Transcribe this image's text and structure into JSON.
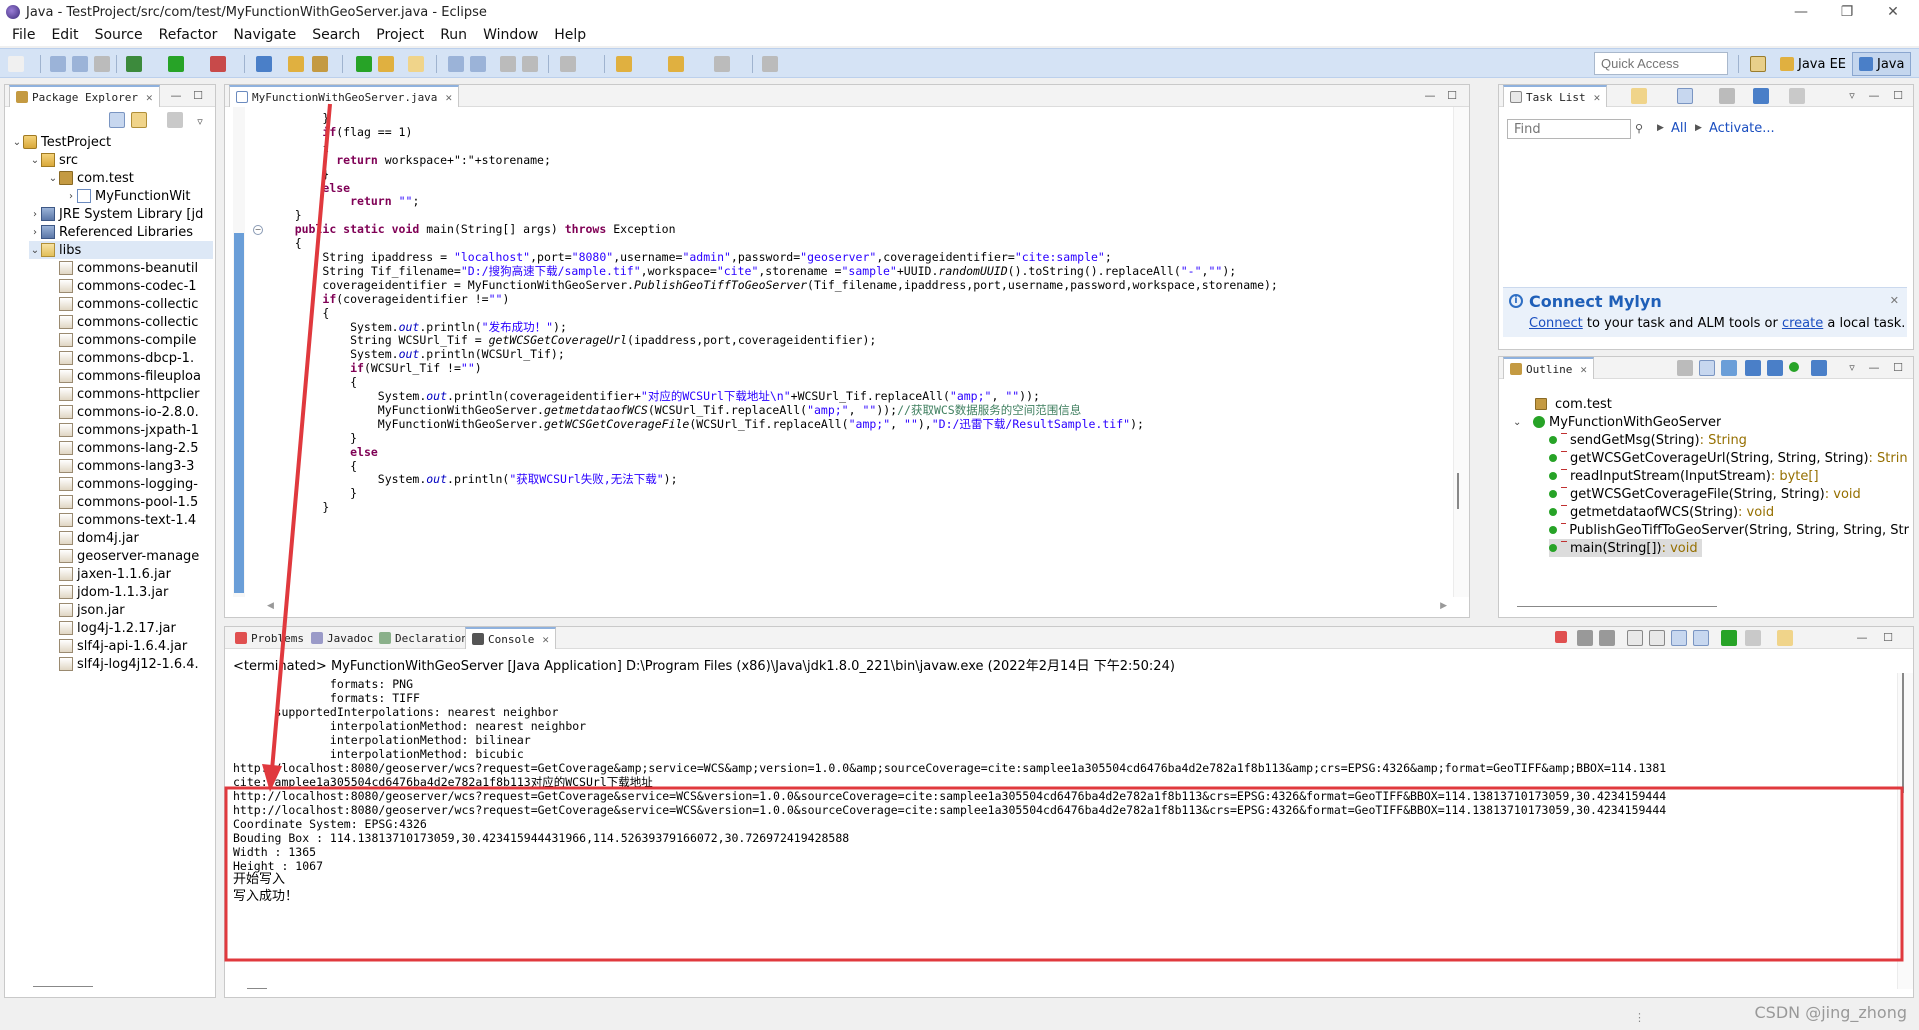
{
  "window": {
    "title": "Java - TestProject/src/com/test/MyFunctionWithGeoServer.java - Eclipse",
    "minimize": "—",
    "maximize": "❐",
    "close": "✕"
  },
  "menu": [
    "File",
    "Edit",
    "Source",
    "Refactor",
    "Navigate",
    "Search",
    "Project",
    "Run",
    "Window",
    "Help"
  ],
  "toolbar": {
    "quick_access_placeholder": "Quick Access",
    "perspectives": [
      {
        "label": "Java EE"
      },
      {
        "label": "Java"
      }
    ]
  },
  "package_explorer": {
    "tab": "Package Explorer",
    "rows": [
      {
        "label": "TestProject",
        "arrow": "⌄"
      },
      {
        "label": "src",
        "arrow": "⌄"
      },
      {
        "label": "com.test",
        "arrow": "⌄"
      },
      {
        "label": "MyFunctionWit",
        "arrow": "›"
      },
      {
        "label": "JRE System Library [jd",
        "arrow": "›"
      },
      {
        "label": "Referenced Libraries",
        "arrow": "›"
      },
      {
        "label": "libs",
        "arrow": "⌄"
      },
      {
        "label": "commons-beanutil"
      },
      {
        "label": "commons-codec-1"
      },
      {
        "label": "commons-collectic"
      },
      {
        "label": "commons-collectic"
      },
      {
        "label": "commons-compile"
      },
      {
        "label": "commons-dbcp-1."
      },
      {
        "label": "commons-fileuploa"
      },
      {
        "label": "commons-httpclier"
      },
      {
        "label": "commons-io-2.8.0."
      },
      {
        "label": "commons-jxpath-1"
      },
      {
        "label": "commons-lang-2.5"
      },
      {
        "label": "commons-lang3-3"
      },
      {
        "label": "commons-logging-"
      },
      {
        "label": "commons-pool-1.5"
      },
      {
        "label": "commons-text-1.4"
      },
      {
        "label": "dom4j.jar"
      },
      {
        "label": "geoserver-manage"
      },
      {
        "label": "jaxen-1.1.6.jar"
      },
      {
        "label": "jdom-1.1.3.jar"
      },
      {
        "label": "json.jar"
      },
      {
        "label": "log4j-1.2.17.jar"
      },
      {
        "label": "slf4j-api-1.6.4.jar"
      },
      {
        "label": "slf4j-log4j12-1.6.4."
      }
    ]
  },
  "editor": {
    "tab": "MyFunctionWithGeoServer.java",
    "lines": [
      [
        {
          "t": "        }"
        }
      ],
      [
        {
          "t": "        "
        },
        {
          "t": "if",
          "c": "kw"
        },
        {
          "t": "(flag == 1)"
        }
      ],
      [
        {
          "t": "        {"
        }
      ],
      [
        {
          "t": "          "
        },
        {
          "t": "return",
          "c": "kw"
        },
        {
          "t": " workspace+\":\"+storename;"
        }
      ],
      [
        {
          "t": "        }"
        }
      ],
      [
        {
          "t": "        "
        },
        {
          "t": "else",
          "c": "kw"
        }
      ],
      [
        {
          "t": "            "
        },
        {
          "t": "return",
          "c": "kw"
        },
        {
          "t": " "
        },
        {
          "t": "\"\"",
          "c": "str"
        },
        {
          "t": ";"
        }
      ],
      [
        {
          "t": "    }"
        }
      ],
      [
        {
          "t": "    "
        },
        {
          "t": "public static void",
          "c": "kw"
        },
        {
          "t": " main(String[] args) "
        },
        {
          "t": "throws",
          "c": "kw"
        },
        {
          "t": " Exception"
        }
      ],
      [
        {
          "t": "    {"
        }
      ],
      [
        {
          "t": "        String ipaddress = "
        },
        {
          "t": "\"localhost\"",
          "c": "str"
        },
        {
          "t": ",port="
        },
        {
          "t": "\"8080\"",
          "c": "str"
        },
        {
          "t": ",username="
        },
        {
          "t": "\"admin\"",
          "c": "str"
        },
        {
          "t": ",password="
        },
        {
          "t": "\"geoserver\"",
          "c": "str"
        },
        {
          "t": ",coverageidentifier="
        },
        {
          "t": "\"cite:sample\"",
          "c": "str"
        },
        {
          "t": ";"
        }
      ],
      [
        {
          "t": "        String Tif_filename="
        },
        {
          "t": "\"D:/搜狗高速下载/sample.tif\"",
          "c": "str"
        },
        {
          "t": ",workspace="
        },
        {
          "t": "\"cite\"",
          "c": "str"
        },
        {
          "t": ",storename ="
        },
        {
          "t": "\"sample\"",
          "c": "str"
        },
        {
          "t": "+UUID."
        },
        {
          "t": "randomUUID",
          "c": "ital"
        },
        {
          "t": "().toString().replaceAll("
        },
        {
          "t": "\"-\"",
          "c": "str"
        },
        {
          "t": ","
        },
        {
          "t": "\"\"",
          "c": "str"
        },
        {
          "t": ");"
        }
      ],
      [
        {
          "t": "        coverageidentifier = MyFunctionWithGeoServer."
        },
        {
          "t": "PublishGeoTiffToGeoServer",
          "c": "ital"
        },
        {
          "t": "(Tif_filename,ipaddress,port,username,password,workspace,storename);"
        }
      ],
      [
        {
          "t": "        "
        },
        {
          "t": "if",
          "c": "kw"
        },
        {
          "t": "(coverageidentifier !="
        },
        {
          "t": "\"\"",
          "c": "str"
        },
        {
          "t": ")"
        }
      ],
      [
        {
          "t": "        {"
        }
      ],
      [
        {
          "t": "            System."
        },
        {
          "t": "out",
          "c": "fld"
        },
        {
          "t": ".println("
        },
        {
          "t": "\"发布成功！\"",
          "c": "str"
        },
        {
          "t": ");"
        }
      ],
      [
        {
          "t": "            String WCSUrl_Tif = "
        },
        {
          "t": "getWCSGetCoverageUrl",
          "c": "ital"
        },
        {
          "t": "(ipaddress,port,coverageidentifier);"
        }
      ],
      [
        {
          "t": "            System."
        },
        {
          "t": "out",
          "c": "fld"
        },
        {
          "t": ".println(WCSUrl_Tif);"
        }
      ],
      [
        {
          "t": "            "
        },
        {
          "t": "if",
          "c": "kw"
        },
        {
          "t": "(WCSUrl_Tif !="
        },
        {
          "t": "\"\"",
          "c": "str"
        },
        {
          "t": ")"
        }
      ],
      [
        {
          "t": "            {"
        }
      ],
      [
        {
          "t": "                System."
        },
        {
          "t": "out",
          "c": "fld"
        },
        {
          "t": ".println(coverageidentifier+"
        },
        {
          "t": "\"对应的WCSUrl下载地址\\n\"",
          "c": "str"
        },
        {
          "t": "+WCSUrl_Tif.replaceAll("
        },
        {
          "t": "\"amp;\"",
          "c": "str"
        },
        {
          "t": ", "
        },
        {
          "t": "\"\"",
          "c": "str"
        },
        {
          "t": "));"
        }
      ],
      [
        {
          "t": "                MyFunctionWithGeoServer."
        },
        {
          "t": "getmetdataofWCS",
          "c": "ital"
        },
        {
          "t": "(WCSUrl_Tif.replaceAll("
        },
        {
          "t": "\"amp;\"",
          "c": "str"
        },
        {
          "t": ", "
        },
        {
          "t": "\"\"",
          "c": "str"
        },
        {
          "t": "));"
        },
        {
          "t": "//获取WCS数据服务的空间范围信息",
          "c": "cmt"
        }
      ],
      [
        {
          "t": "                MyFunctionWithGeoServer."
        },
        {
          "t": "getWCSGetCoverageFile",
          "c": "ital"
        },
        {
          "t": "(WCSUrl_Tif.replaceAll("
        },
        {
          "t": "\"amp;\"",
          "c": "str"
        },
        {
          "t": ", "
        },
        {
          "t": "\"\"",
          "c": "str"
        },
        {
          "t": "),"
        },
        {
          "t": "\"D:/迅雷下载/ResultSample.tif\"",
          "c": "str"
        },
        {
          "t": ");"
        }
      ],
      [
        {
          "t": "            }"
        }
      ],
      [
        {
          "t": "            "
        },
        {
          "t": "else",
          "c": "kw"
        }
      ],
      [
        {
          "t": "            {"
        }
      ],
      [
        {
          "t": "                System."
        },
        {
          "t": "out",
          "c": "fld"
        },
        {
          "t": ".println("
        },
        {
          "t": "\"获取WCSUrl失败,无法下载\"",
          "c": "str"
        },
        {
          "t": ");"
        }
      ],
      [
        {
          "t": "            }"
        }
      ],
      [
        {
          "t": "        }"
        }
      ]
    ]
  },
  "task_list": {
    "tab": "Task List",
    "find_placeholder": "Find",
    "all_label": "All",
    "activate_label": "Activate...",
    "connect_title": "Connect Mylyn",
    "connect_link": "Connect",
    "connect_text": " to your task and ALM tools or ",
    "create_link": "create",
    "connect_tail": " a local task."
  },
  "outline": {
    "tab": "Outline",
    "package": "com.test",
    "class": "MyFunctionWithGeoServer",
    "methods": [
      {
        "name": "sendGetMsg(String)",
        "type": " : String"
      },
      {
        "name": "getWCSGetCoverageUrl(String, String, String)",
        "type": " : Strin"
      },
      {
        "name": "readInputStream(InputStream)",
        "type": " : byte[]"
      },
      {
        "name": "getWCSGetCoverageFile(String, String)",
        "type": " : void"
      },
      {
        "name": "getmetdataofWCS(String)",
        "type": " : void"
      },
      {
        "name": "PublishGeoTiffToGeoServer(String, String, String, Str",
        "type": ""
      },
      {
        "name": "main(String[])",
        "type": " : void"
      }
    ]
  },
  "console": {
    "tabs": [
      "Problems",
      "Javadoc",
      "Declaration",
      "Console"
    ],
    "header": "<terminated> MyFunctionWithGeoServer [Java Application] D:\\Program Files (x86)\\Java\\jdk1.8.0_221\\bin\\javaw.exe (2022年2月14日 下午2:50:24)",
    "lines": [
      "              formats: PNG",
      "              formats: TIFF",
      "      supportedInterpolations: nearest neighbor",
      "              interpolationMethod: nearest neighbor",
      "              interpolationMethod: bilinear",
      "              interpolationMethod: bicubic",
      "http://localhost:8080/geoserver/wcs?request=GetCoverage&amp;service=WCS&amp;version=1.0.0&amp;sourceCoverage=cite:samplee1a305504cd6476ba4d2e782a1f8b113&amp;crs=EPSG:4326&amp;format=GeoTIFF&amp;BBOX=114.1381",
      "cite:samplee1a305504cd6476ba4d2e782a1f8b113对应的WCSUrl下载地址",
      "http://localhost:8080/geoserver/wcs?request=GetCoverage&service=WCS&version=1.0.0&sourceCoverage=cite:samplee1a305504cd6476ba4d2e782a1f8b113&crs=EPSG:4326&format=GeoTIFF&BBOX=114.13813710173059,30.4234159444",
      "http://localhost:8080/geoserver/wcs?request=GetCoverage&service=WCS&version=1.0.0&sourceCoverage=cite:samplee1a305504cd6476ba4d2e782a1f8b113&crs=EPSG:4326&format=GeoTIFF&BBOX=114.13813710173059,30.4234159444",
      "Coordinate System: EPSG:4326",
      "Bouding Box : 114.13813710173059,30.423415944431966,114.52639379166072,30.726972419428588",
      "Width : 1365",
      "Height : 1067",
      "开始写入",
      "写入成功！"
    ]
  },
  "watermark": "CSDN @jing_zhong",
  "colors": {
    "annotation": "#e0393e",
    "toolbar": "#d5e3f5",
    "keyword": "#7f0055",
    "string": "#2a00ff"
  }
}
